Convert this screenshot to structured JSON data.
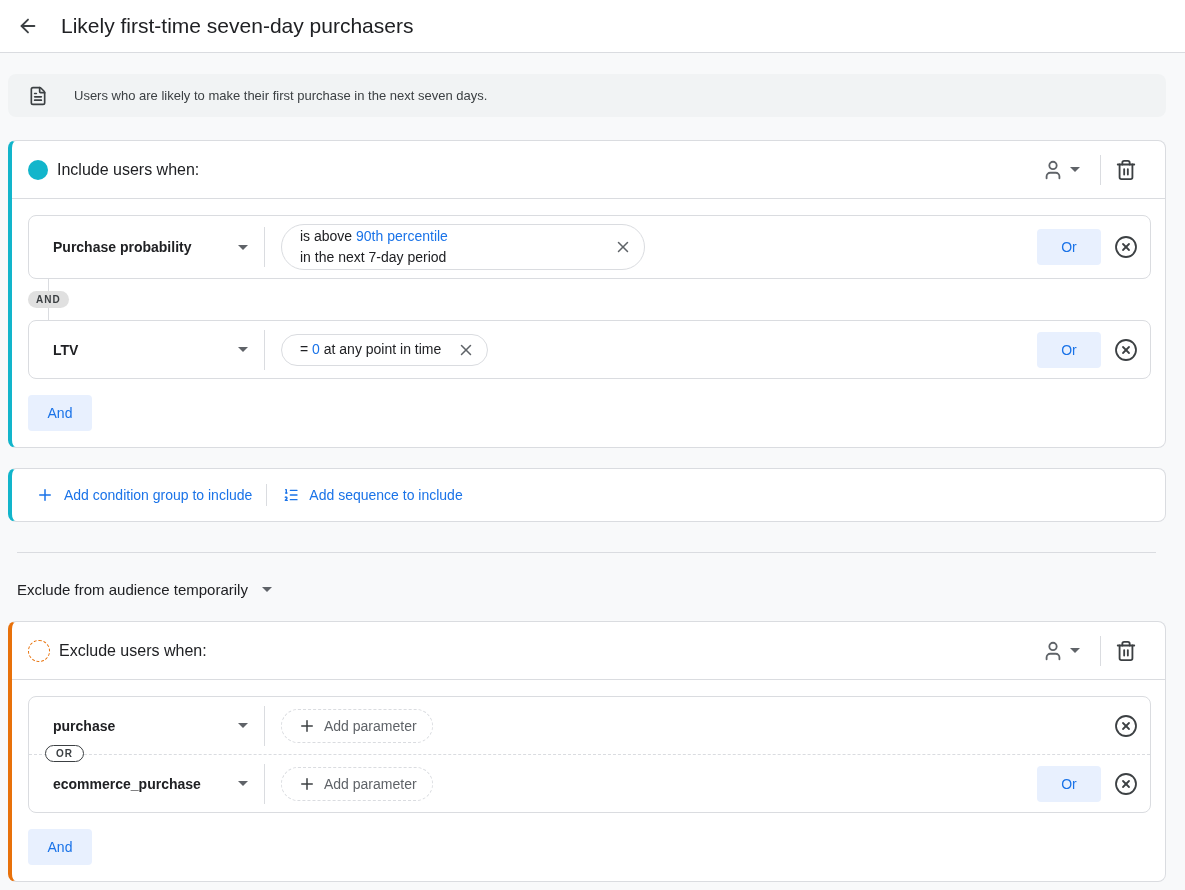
{
  "header": {
    "title": "Likely first-time seven-day purchasers"
  },
  "description": "Users who are likely to make their first purchase in the next seven days.",
  "include_group": {
    "kind": "include",
    "heading": "Include users when:",
    "block_joiner": "AND",
    "and_button": "And",
    "blocks": [
      {
        "rows": [
          {
            "field": "Purchase probability",
            "chip": {
              "kind": "value",
              "lines": [
                "is above **90th percentile**",
                "in the next 7-day period"
              ]
            },
            "or_button": "Or"
          }
        ]
      },
      {
        "rows": [
          {
            "field": "LTV",
            "chip": {
              "kind": "value",
              "lines": [
                "= **0** at any point in time"
              ]
            },
            "or_button": "Or"
          }
        ]
      }
    ]
  },
  "add_actions": [
    {
      "kind": "group",
      "label": "Add condition group to include"
    },
    {
      "kind": "sequence",
      "label": "Add sequence to include"
    }
  ],
  "exclude_selector": {
    "label": "Exclude from audience temporarily"
  },
  "exclude_group": {
    "kind": "exclude",
    "heading": "Exclude users when:",
    "row_joiner": "OR",
    "and_button": "And",
    "blocks": [
      {
        "rows": [
          {
            "field": "purchase",
            "chip": {
              "kind": "add",
              "label": "Add parameter"
            }
          },
          {
            "field": "ecommerce_purchase",
            "chip": {
              "kind": "add",
              "label": "Add parameter"
            },
            "or_button": "Or"
          }
        ]
      }
    ]
  }
}
